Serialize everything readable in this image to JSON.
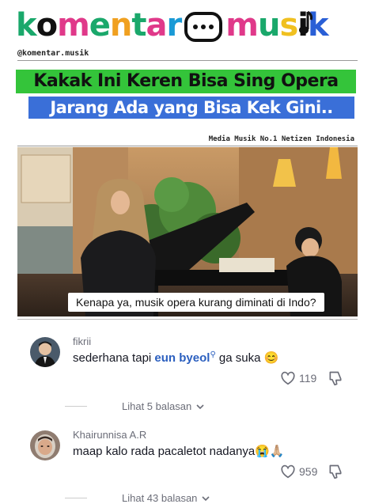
{
  "brand": {
    "logo_part1": "komentar",
    "logo_part2": "musik",
    "logo_letters1": [
      {
        "ch": "k",
        "color": "#1aa86b"
      },
      {
        "ch": "o",
        "color": "#111111"
      },
      {
        "ch": "m",
        "color": "#e0398a"
      },
      {
        "ch": "e",
        "color": "#1aa86b"
      },
      {
        "ch": "n",
        "color": "#f0a020"
      },
      {
        "ch": "t",
        "color": "#1aa86b"
      },
      {
        "ch": "a",
        "color": "#e0398a"
      },
      {
        "ch": "r",
        "color": "#1a9ad6"
      }
    ],
    "logo_letters2": [
      {
        "ch": "m",
        "color": "#e0398a"
      },
      {
        "ch": "u",
        "color": "#1aa86b"
      },
      {
        "ch": "s",
        "color": "#f0c020"
      },
      {
        "ch": "i",
        "color": "#111111"
      },
      {
        "ch": "k",
        "color": "#2a5fd6"
      }
    ],
    "handle": "@komentar.musik",
    "tagline": "Media Musik No.1 Netizen Indonesia"
  },
  "headline": {
    "line1": "Kakak Ini Keren Bisa Sing Opera",
    "line2": "Jarang Ada yang Bisa Kek Gini..",
    "line1_bg": "#34c43a",
    "line2_bg": "#3a6fd8"
  },
  "video": {
    "caption": "Kenapa ya, musik opera kurang diminati di Indo?"
  },
  "comments": [
    {
      "username": "fikrii",
      "text_before": "sederhana tapi ",
      "highlight": "eun byeol",
      "text_after": " ga suka 😊",
      "likes": "119",
      "replies_label": "Lihat 5 balasan",
      "avatar_icon": "avatar-man-suit"
    },
    {
      "username": "Khairunnisa A.R",
      "text": "maap kalo rada pacaletot nadanya😭🙏🏼",
      "likes": "959",
      "replies_label": "Lihat 43 balasan",
      "avatar_icon": "avatar-woman-hijab"
    }
  ],
  "colors": {
    "link": "#2b5fbf",
    "muted": "#6b6d78"
  }
}
